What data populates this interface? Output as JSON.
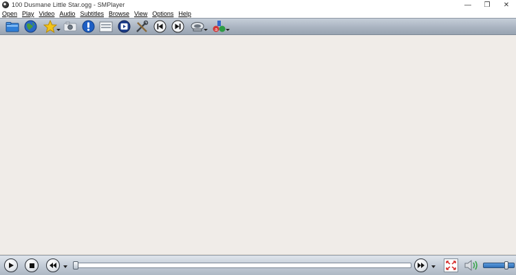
{
  "window": {
    "title": "100 Dusmane Little Star.ogg - SMPlayer",
    "controls": {
      "minimize": "—",
      "restore": "❐",
      "close": "✕"
    }
  },
  "menu": {
    "items": [
      {
        "label": "Open"
      },
      {
        "label": "Play"
      },
      {
        "label": "Video"
      },
      {
        "label": "Audio"
      },
      {
        "label": "Subtitles"
      },
      {
        "label": "Browse"
      },
      {
        "label": "View"
      },
      {
        "label": "Options"
      },
      {
        "label": "Help"
      }
    ]
  },
  "toolbar": {
    "buttons": [
      {
        "icon": "open-folder-icon"
      },
      {
        "icon": "open-url-globe-icon"
      },
      {
        "icon": "favorites-star-icon",
        "has_dropdown": true
      },
      {
        "icon": "screenshot-camera-icon"
      },
      {
        "icon": "info-icon"
      },
      {
        "icon": "playlist-icon"
      },
      {
        "icon": "youtube-browser-icon"
      },
      {
        "icon": "preferences-tools-icon"
      },
      {
        "icon": "previous-track-icon"
      },
      {
        "icon": "next-track-icon"
      },
      {
        "icon": "audio-track-icon",
        "has_dropdown": true
      },
      {
        "icon": "subtitle-track-icon",
        "has_dropdown": true
      }
    ]
  },
  "controls": {
    "seek_position": 0,
    "volume_level": 0.8,
    "colors": {
      "volume_fill": "#2e6fb8",
      "fullscreen_arrows": "#d63030",
      "speaker_wave": "#3aa54a"
    }
  }
}
